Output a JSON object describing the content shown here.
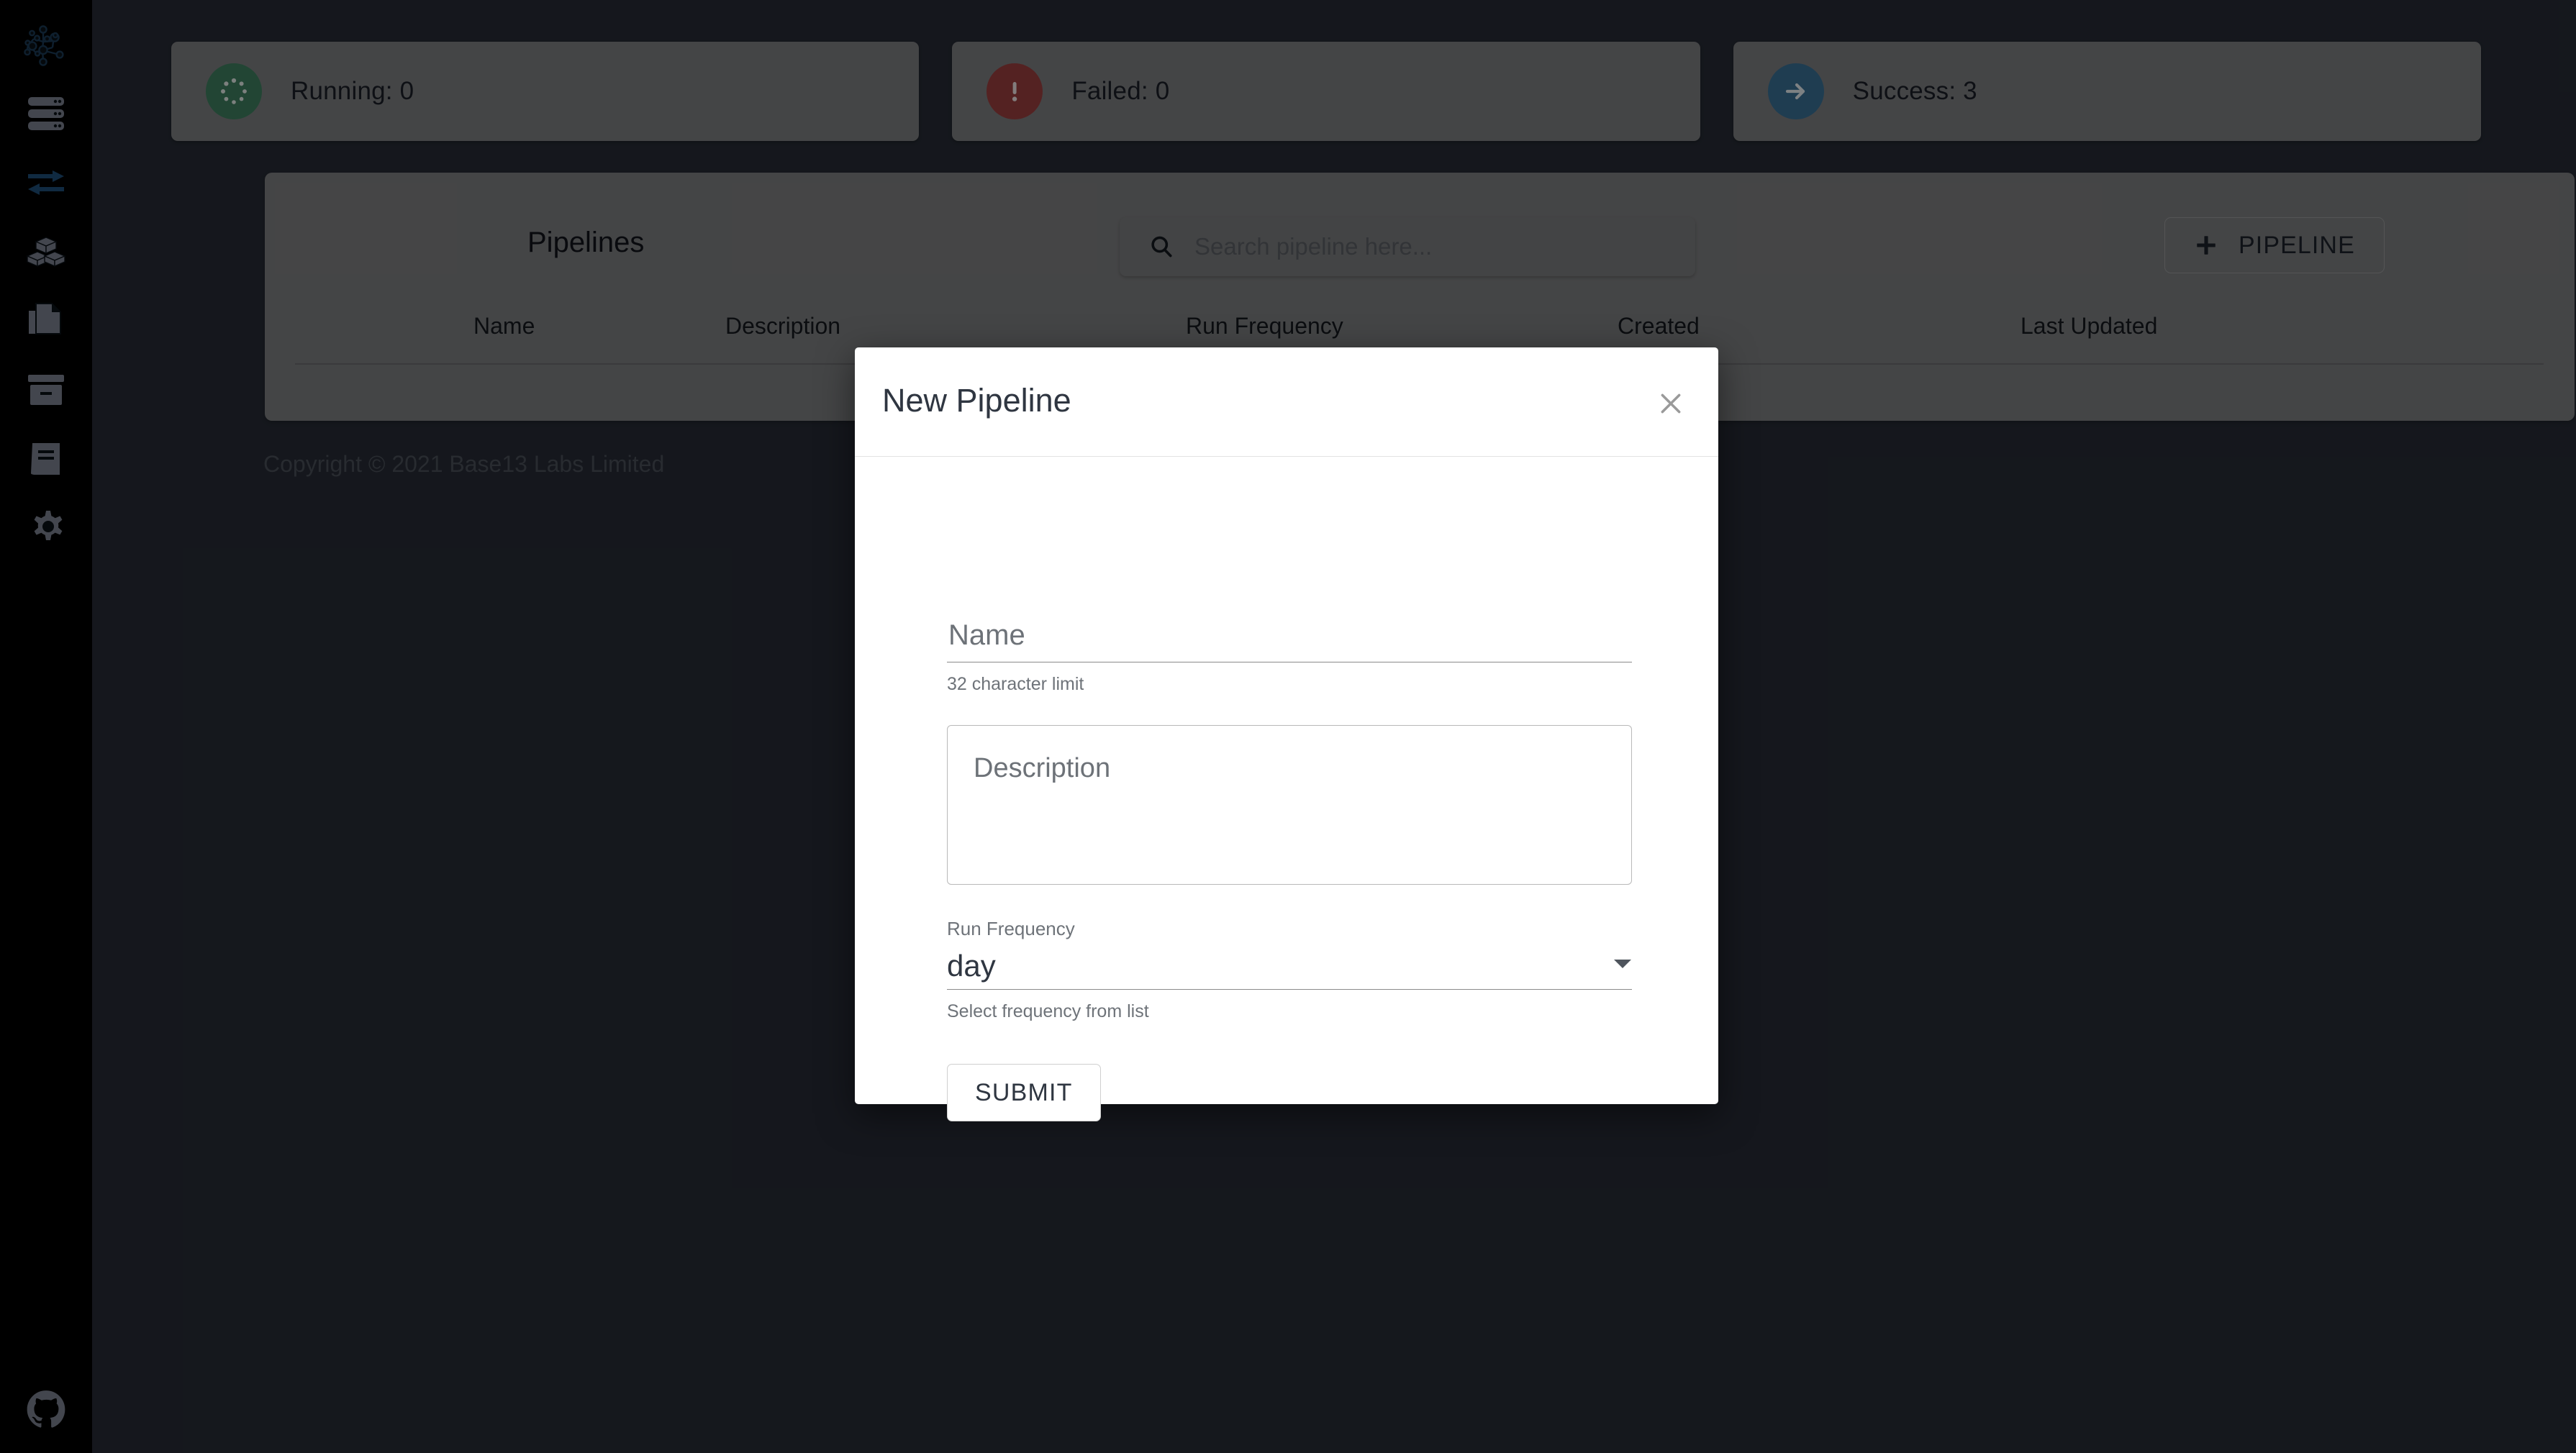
{
  "sidebar": {
    "logo_icon": "network-graph-logo-icon",
    "items": [
      {
        "icon": "server-stack-icon",
        "name": "servers"
      },
      {
        "icon": "exchange-arrows-icon",
        "name": "transfers"
      },
      {
        "icon": "cubes-icon",
        "name": "blocks"
      },
      {
        "icon": "copy-documents-icon",
        "name": "documents"
      },
      {
        "icon": "archive-box-icon",
        "name": "archive"
      },
      {
        "icon": "book-icon",
        "name": "docs"
      },
      {
        "icon": "gear-icon",
        "name": "settings"
      }
    ],
    "bottom_icon": "github-icon"
  },
  "status_cards": [
    {
      "label": "Running: 0",
      "icon": "spinner-dots-icon",
      "color": "#3f8060",
      "name": "running"
    },
    {
      "label": "Failed: 0",
      "icon": "exclamation-circle-icon",
      "color": "#9c4040",
      "name": "failed"
    },
    {
      "label": "Success: 3",
      "icon": "arrow-right-circle-icon",
      "color": "#3a7197",
      "name": "success"
    }
  ],
  "panel": {
    "title": "Pipelines",
    "search": {
      "placeholder": "Search pipeline here...",
      "value": "",
      "icon": "search-icon"
    },
    "add_button": {
      "label": "PIPELINE",
      "icon": "plus-icon"
    },
    "columns": [
      "Name",
      "Description",
      "Run Frequency",
      "Created",
      "Last Updated"
    ]
  },
  "footer": {
    "copyright": "Copyright © 2021 Base13 Labs Limited"
  },
  "dialog": {
    "title": "New Pipeline",
    "close_icon": "close-icon",
    "name_field": {
      "placeholder": "Name",
      "value": "",
      "helper": "32 character limit"
    },
    "description_field": {
      "placeholder": "Description",
      "value": ""
    },
    "frequency_field": {
      "label": "Run Frequency",
      "value": "day",
      "helper": "Select frequency from list",
      "caret_icon": "chevron-down-icon"
    },
    "submit_label": "SUBMIT"
  },
  "colors": {
    "page_background": "#272c36",
    "sidebar_background": "#000000",
    "card_surface": "#7f8082",
    "accent_blue": "#1f4e79",
    "icon_gray": "#7c8290",
    "dialog_surface": "#ffffff"
  }
}
